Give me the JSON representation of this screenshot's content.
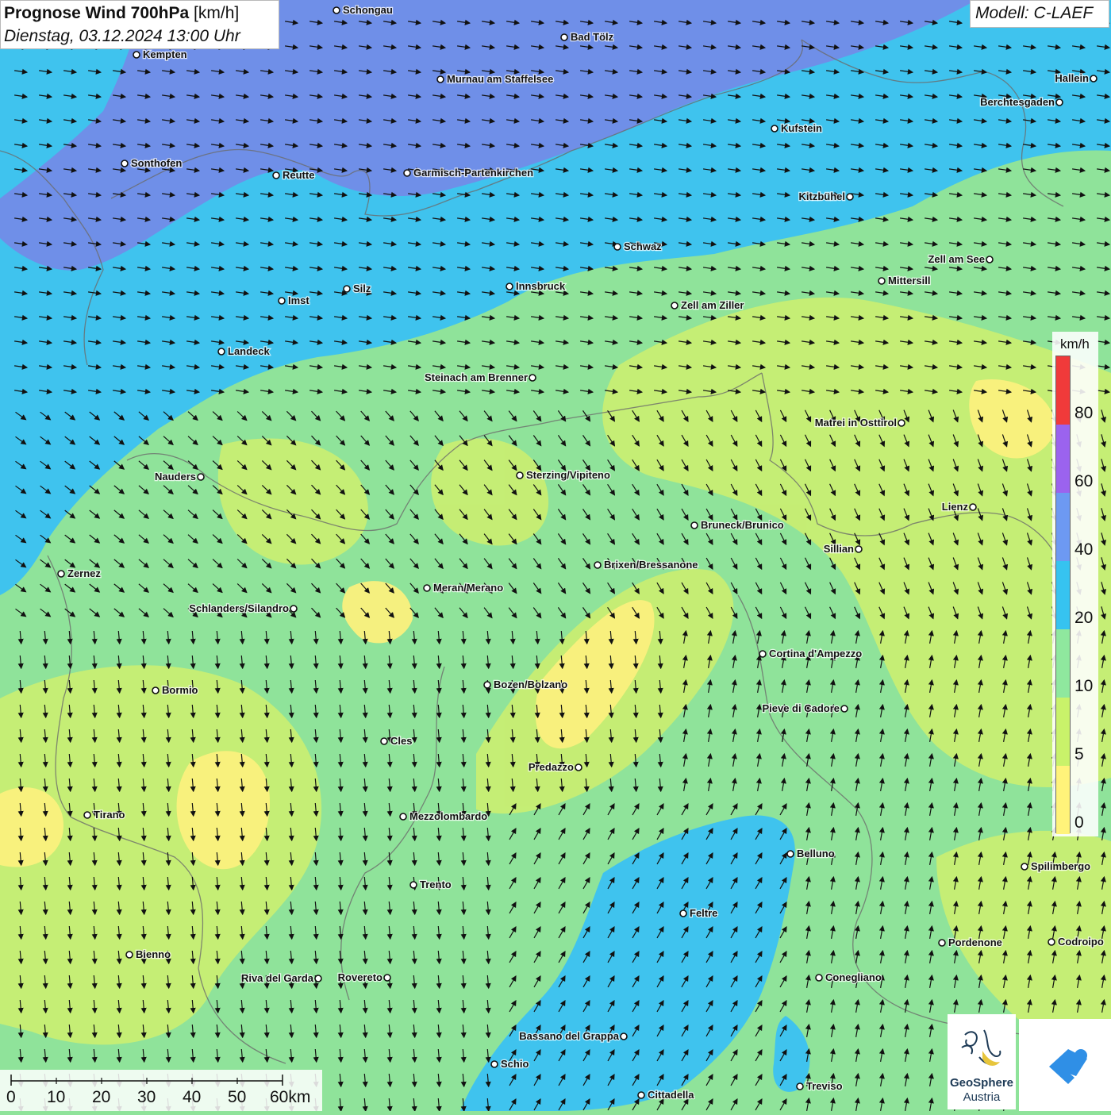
{
  "header": {
    "title_bold": "Prognose Wind 700hPa",
    "title_unit": "[km/h]",
    "datetime": "Dienstag, 03.12.2024 13:00 Uhr"
  },
  "model_label": "Modell: C-LAEF",
  "legend": {
    "unit": "km/h",
    "labels": [
      "80",
      "60",
      "40",
      "20",
      "10",
      "5",
      "0"
    ],
    "colors": [
      "#f03a3a",
      "#9b63ee",
      "#6d99f2",
      "#36c3f0",
      "#8fe89e",
      "#c9f26a",
      "#fff37a"
    ]
  },
  "scale_bar": {
    "labels": [
      "0",
      "10",
      "20",
      "30",
      "40",
      "50",
      "60km"
    ]
  },
  "logo": {
    "line1": "GeoSphere",
    "line2": "Austria"
  },
  "cities": [
    "Schongau",
    "Bad Tölz",
    "Kempten",
    "Murnau am Staffelsee",
    "Hallein",
    "Berchtesgaden",
    "Kufstein",
    "Sonthofen",
    "Reutte",
    "Garmisch-Partenkirchen",
    "Kitzbühel",
    "Schwaz",
    "Zell am See",
    "Mittersill",
    "Innsbruck",
    "Imst",
    "Silz",
    "Zell am Ziller",
    "Landeck",
    "Steinach am Brenner",
    "Matrei in Osttirol",
    "Nauders",
    "Sterzing/Vipiteno",
    "Lienz",
    "Bruneck/Brunico",
    "Sillian",
    "Zernez",
    "Brixen/Bressanone",
    "Meran/Merano",
    "Schlanders/Silandro",
    "Cortina d'Ampezzo",
    "Bozen/Bolzano",
    "Bormio",
    "Pieve di Cadore",
    "Cles",
    "Predazzo",
    "Tirano",
    "Mezzolombardo",
    "Belluno",
    "Spilimbergo",
    "Trento",
    "Feltre",
    "Pordenone",
    "Codroipo",
    "Bienno",
    "Riva del Garda",
    "Rovereto",
    "Conegliano",
    "Bassano del Grappa",
    "Schio",
    "Treviso",
    "Cittadella"
  ]
}
